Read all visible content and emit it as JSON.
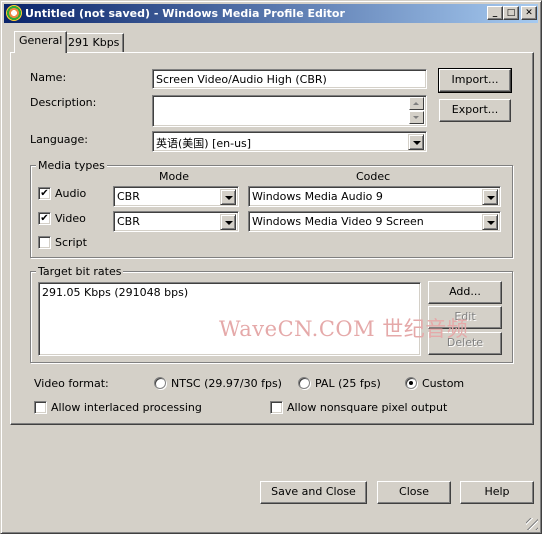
{
  "window": {
    "title": "Untitled (not saved) - Windows Media Profile Editor",
    "minimize_glyph": "_",
    "maximize_glyph": "□",
    "close_glyph": "✕"
  },
  "tabs": [
    {
      "label": "General",
      "active": true
    },
    {
      "label": "291 Kbps",
      "active": false
    }
  ],
  "general": {
    "name_label": "Name:",
    "name_value": "Screen Video/Audio High (CBR)",
    "description_label": "Description:",
    "description_value": "",
    "language_label": "Language:",
    "language_value": "英语(美国) [en-us]",
    "import_label": "Import...",
    "export_label": "Export..."
  },
  "media_types": {
    "title": "Media types",
    "mode_header": "Mode",
    "codec_header": "Codec",
    "rows": [
      {
        "label": "Audio",
        "checked": true,
        "mode": "CBR",
        "codec": "Windows Media Audio 9"
      },
      {
        "label": "Video",
        "checked": true,
        "mode": "CBR",
        "codec": "Windows Media Video 9 Screen"
      },
      {
        "label": "Script",
        "checked": false
      }
    ]
  },
  "bitrates": {
    "title": "Target bit rates",
    "items": [
      "291.05 Kbps (291048 bps)"
    ],
    "add_label": "Add...",
    "edit_label": "Edit",
    "delete_label": "Delete"
  },
  "video_format": {
    "label": "Video format:",
    "options": [
      {
        "label": "NTSC (29.97/30 fps)",
        "selected": false
      },
      {
        "label": "PAL (25 fps)",
        "selected": false
      },
      {
        "label": "Custom",
        "selected": true
      }
    ],
    "interlaced_label": "Allow interlaced processing",
    "interlaced_checked": false,
    "nonsquare_label": "Allow nonsquare pixel output",
    "nonsquare_checked": false
  },
  "footer": {
    "save_close_label": "Save and Close",
    "close_label": "Close",
    "help_label": "Help"
  },
  "watermark": "WaveCN.COM 世纪音频",
  "colors": {
    "titlebar_start": "#0a246a",
    "titlebar_end": "#a6caf0",
    "face": "#d4d0c8",
    "watermark": "#e5a9a9"
  }
}
